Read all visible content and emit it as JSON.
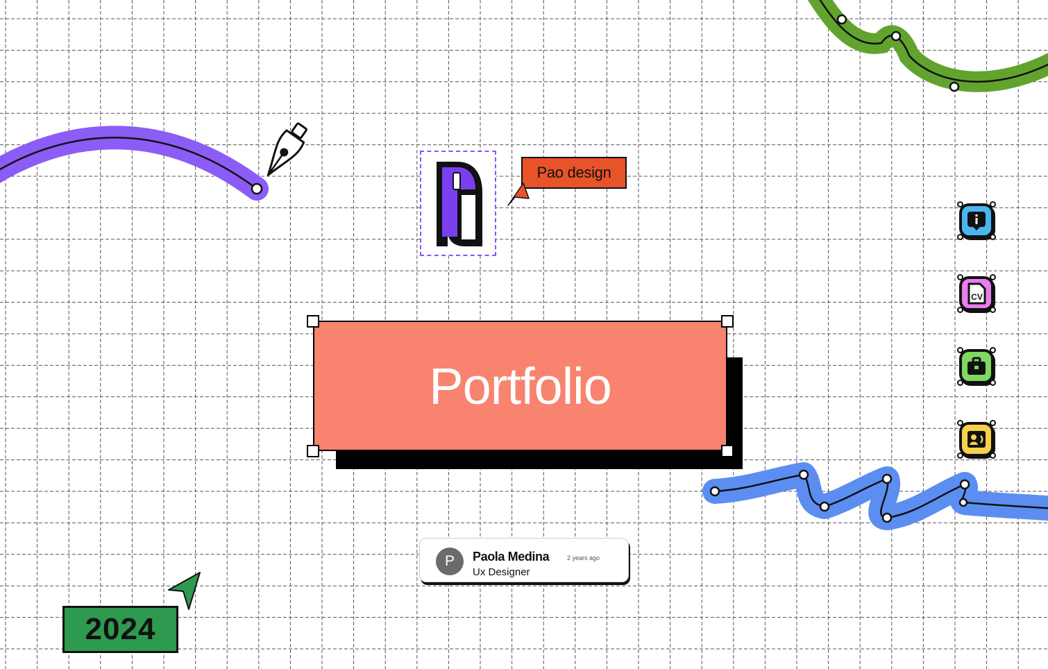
{
  "canvas": {
    "background": "#ffffff",
    "grid_line_color": "#555555"
  },
  "logo": {
    "icon": "pd-monogram-logo",
    "accent": "#8b52ff"
  },
  "tag": {
    "label": "Pao design",
    "color": "#e8532a",
    "cursor_icon": "pointer-cursor-icon"
  },
  "hero": {
    "title": "Portfolio",
    "fill": "#f8836e"
  },
  "user_card": {
    "avatar_initial": "P",
    "name": "Paola Medina",
    "time": "2 years ago",
    "role": "Ux Designer"
  },
  "year": {
    "label": "2024",
    "color": "#2e9a4f",
    "cursor_icon": "pointer-cursor-icon"
  },
  "side_nav": [
    {
      "name": "info",
      "icon": "info-icon",
      "color": "#49b7ee"
    },
    {
      "name": "cv",
      "icon": "cv-file-icon",
      "label": "CV",
      "color": "#e97ded"
    },
    {
      "name": "work",
      "icon": "briefcase-icon",
      "color": "#7ed861"
    },
    {
      "name": "contact",
      "icon": "contact-card-icon",
      "color": "#f7d14b"
    }
  ],
  "decorations": {
    "purple_stroke": "#8b5cf6",
    "green_stroke": "#62a32e",
    "blue_stroke": "#5b8ef0",
    "pen_tool_icon": "pen-tool-icon"
  }
}
